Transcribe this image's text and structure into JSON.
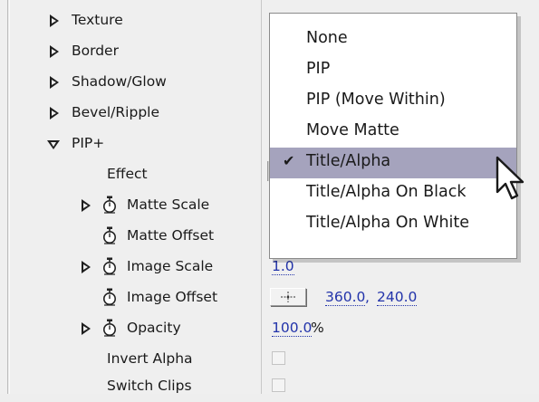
{
  "properties": [
    {
      "label": "Texture",
      "kind": "group"
    },
    {
      "label": "Border",
      "kind": "group"
    },
    {
      "label": "Shadow/Glow",
      "kind": "group"
    },
    {
      "label": "Bevel/Ripple",
      "kind": "group"
    },
    {
      "label": "PIP+",
      "kind": "group-open"
    },
    {
      "label": "Effect",
      "kind": "popup"
    },
    {
      "label": "Matte Scale",
      "kind": "animatable"
    },
    {
      "label": "Matte Offset",
      "kind": "animatable"
    },
    {
      "label": "Image Scale",
      "kind": "animatable",
      "value": "1.0"
    },
    {
      "label": "Image Offset",
      "kind": "animatable",
      "value_x": "360.0",
      "separator": ",",
      "value_y": "240.0"
    },
    {
      "label": "Opacity",
      "kind": "animatable",
      "value": "100.0",
      "unit": "%"
    },
    {
      "label": "Invert Alpha",
      "kind": "checkbox",
      "checked": false
    },
    {
      "label": "Switch Clips",
      "kind": "checkbox",
      "checked": false
    }
  ],
  "effect_menu": {
    "items": [
      "None",
      "PIP",
      "PIP (Move Within)",
      "Move Matte",
      "Title/Alpha",
      "Title/Alpha On Black",
      "Title/Alpha On White"
    ],
    "selected": "Title/Alpha",
    "highlight_color": "#a5a3bd"
  },
  "icons": {
    "disclosure_closed": "triangle-right-icon",
    "disclosure_open": "triangle-down-icon",
    "keyframe": "stopwatch-icon",
    "point": "crosshair-icon",
    "check": "checkmark-icon",
    "cursor": "arrow-cursor-icon"
  },
  "glyphs": {
    "check": "✔"
  },
  "colors": {
    "value_link": "#2233aa",
    "panel_bg": "#efefef"
  }
}
